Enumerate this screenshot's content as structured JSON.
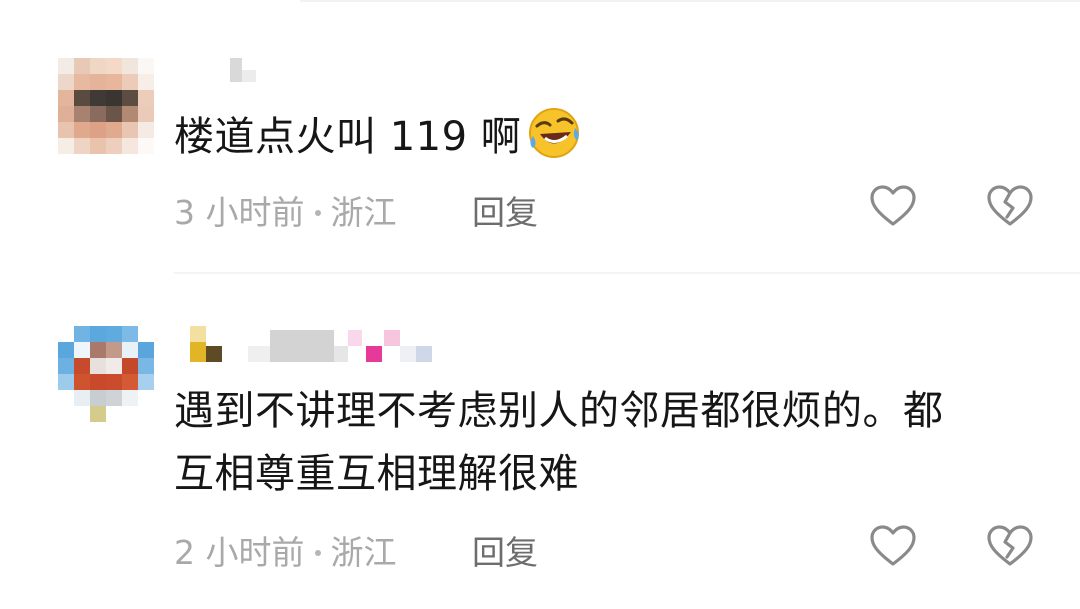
{
  "comments": [
    {
      "text": "楼道点火叫 119 啊",
      "emoji": "laughing-crying-emoji",
      "time": "3 小时前",
      "location": "浙江",
      "reply_label": "回复"
    },
    {
      "text_line1": "遇到不讲理不考虑别人的邻居都很烦的。都",
      "text_line2": "互相尊重互相理解很难",
      "time": "2 小时前",
      "location": "浙江",
      "reply_label": "回复"
    }
  ],
  "colors": {
    "meta_text": "#a9a9a9",
    "reply_text": "#6d6d6d",
    "icon_stroke": "#8a8a8a"
  },
  "icons": [
    "heart-outline-icon",
    "broken-heart-icon"
  ]
}
